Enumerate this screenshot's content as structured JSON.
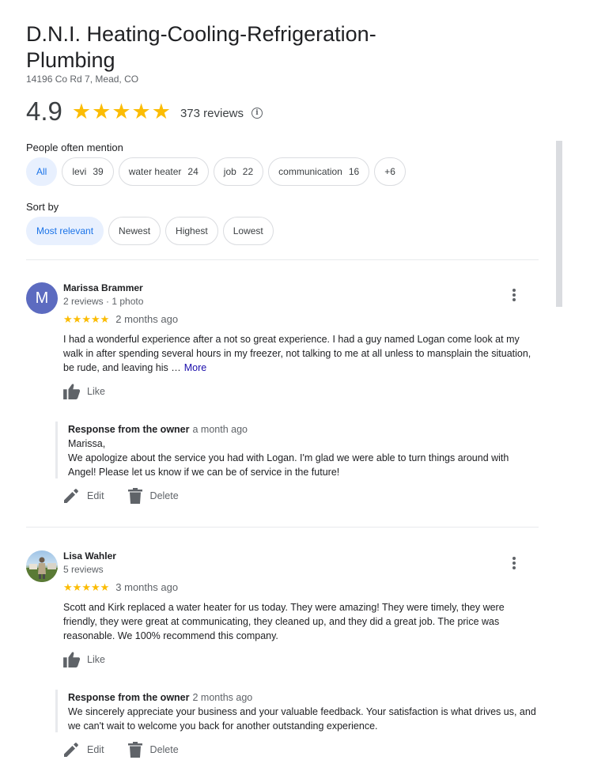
{
  "business": {
    "name": "D.N.I. Heating-Cooling-Refrigeration-Plumbing",
    "address": "14196 Co Rd 7, Mead, CO",
    "rating": "4.9",
    "review_count": "373 reviews",
    "star_color": "#fbbc04"
  },
  "mentions": {
    "label": "People often mention",
    "chips": [
      {
        "label": "All",
        "count": ""
      },
      {
        "label": "levi",
        "count": "39"
      },
      {
        "label": "water heater",
        "count": "24"
      },
      {
        "label": "job",
        "count": "22"
      },
      {
        "label": "communication",
        "count": "16"
      },
      {
        "label": "+6",
        "count": ""
      }
    ]
  },
  "sort": {
    "label": "Sort by",
    "options": [
      "Most relevant",
      "Newest",
      "Highest",
      "Lowest"
    ],
    "selected": "Most relevant"
  },
  "reviews": [
    {
      "initial": "M",
      "name": "Marissa Brammer",
      "meta": "2 reviews · 1 photo",
      "date": "2 months ago",
      "text": "I had a wonderful experience after a not so great experience. I had a guy named Logan come look at my walk in after spending several hours in my freezer, not talking to me at all unless to mansplain the situation, be rude, and leaving his …",
      "more": "More",
      "like": "Like",
      "response": {
        "title": "Response from the owner",
        "date": "a month ago",
        "text": "Marissa,\nWe apologize about the service you had with Logan. I'm glad we were able to turn things around with Angel! Please let us know if we can be of service in the future!"
      },
      "edit": "Edit",
      "delete": "Delete"
    },
    {
      "initial": "",
      "name": "Lisa Wahler",
      "meta": "5 reviews",
      "date": "3 months ago",
      "text": "Scott and Kirk replaced a water heater for us today. They were amazing! They were timely, they were friendly, they were great at communicating, they cleaned up, and they did a great job. The price was reasonable. We 100% recommend this company.",
      "more": "",
      "like": "Like",
      "response": {
        "title": "Response from the owner",
        "date": "2 months ago",
        "text": "We sincerely appreciate your business and your valuable feedback. Your satisfaction is what drives us, and we can't wait to welcome you back for another outstanding experience."
      },
      "edit": "Edit",
      "delete": "Delete"
    }
  ]
}
